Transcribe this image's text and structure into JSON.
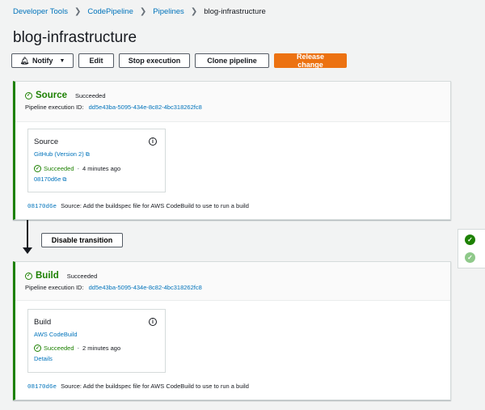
{
  "breadcrumb": {
    "items": [
      "Developer Tools",
      "CodePipeline",
      "Pipelines"
    ],
    "current": "blog-infrastructure"
  },
  "page": {
    "title": "blog-infrastructure"
  },
  "toolbar": {
    "notify_label": "Notify",
    "edit_label": "Edit",
    "stop_label": "Stop execution",
    "clone_label": "Clone pipeline",
    "release_label": "Release change"
  },
  "stages": [
    {
      "name": "Source",
      "status": "Succeeded",
      "execution_label": "Pipeline execution ID:",
      "execution_id": "dd5e43ba-5095-434e-8c82-4bc318262fc8",
      "action": {
        "name": "Source",
        "provider": "GitHub (Version 2)",
        "status": "Succeeded",
        "time": "4 minutes ago",
        "sub_link": "08170d6e"
      },
      "commit": {
        "id": "08170d6e",
        "message": "Source: Add the buildspec file for AWS CodeBuild to use to run a build"
      }
    },
    {
      "name": "Build",
      "status": "Succeeded",
      "execution_label": "Pipeline execution ID:",
      "execution_id": "dd5e43ba-5095-434e-8c82-4bc318262fc8",
      "action": {
        "name": "Build",
        "provider": "AWS CodeBuild",
        "status": "Succeeded",
        "time": "2 minutes ago",
        "sub_link": "Details"
      },
      "commit": {
        "id": "08170d6e",
        "message": "Source: Add the buildspec file for AWS CodeBuild to use to run a build"
      }
    }
  ],
  "transition": {
    "button_label": "Disable transition"
  },
  "colors": {
    "success": "#1d8102",
    "primary": "#ec7211",
    "link": "#0073bb"
  },
  "icons": {
    "notify": "bell-icon",
    "external": "external-link-icon",
    "info": "info-icon",
    "status": "check-circle-icon"
  }
}
